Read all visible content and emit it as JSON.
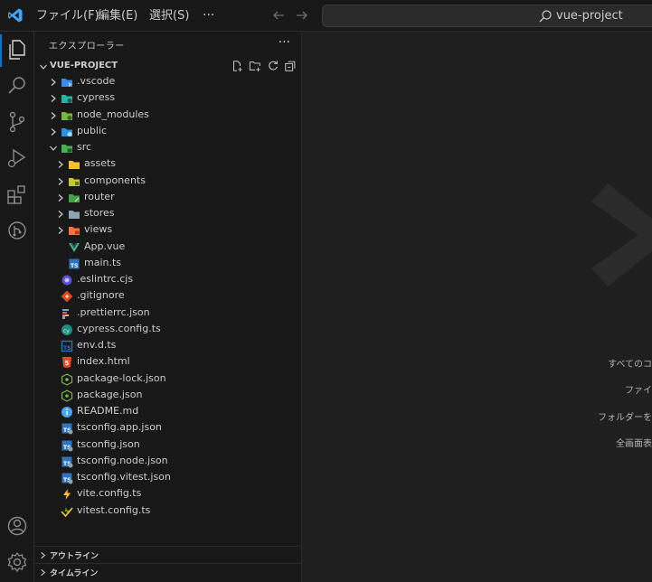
{
  "titlebar": {
    "menus": [
      "ファイル(F)",
      "編集(E)",
      "選択(S)"
    ],
    "more": "···",
    "search_text": "vue-project"
  },
  "sidebar": {
    "title": "エクスプローラー",
    "more": "···",
    "project_name": "VUE-PROJECT",
    "items": [
      {
        "label": ".vscode",
        "type": "folder",
        "icon": "vscode-folder-icon"
      },
      {
        "label": "cypress",
        "type": "folder",
        "icon": "cypress-folder-icon"
      },
      {
        "label": "node_modules",
        "type": "folder",
        "icon": "node-folder-icon"
      },
      {
        "label": "public",
        "type": "folder",
        "icon": "public-folder-icon"
      },
      {
        "label": "src",
        "type": "folder",
        "icon": "src-folder-icon"
      },
      {
        "label": "assets",
        "type": "folder",
        "icon": "assets-folder-icon"
      },
      {
        "label": "components",
        "type": "folder",
        "icon": "components-folder-icon"
      },
      {
        "label": "router",
        "type": "folder",
        "icon": "router-folder-icon"
      },
      {
        "label": "stores",
        "type": "folder",
        "icon": "stores-folder-icon"
      },
      {
        "label": "views",
        "type": "folder",
        "icon": "views-folder-icon"
      },
      {
        "label": "App.vue",
        "type": "file",
        "icon": "vue-file-icon"
      },
      {
        "label": "main.ts",
        "type": "file",
        "icon": "typescript-file-icon"
      },
      {
        "label": ".eslintrc.cjs",
        "type": "file",
        "icon": "eslint-file-icon"
      },
      {
        "label": ".gitignore",
        "type": "file",
        "icon": "git-file-icon"
      },
      {
        "label": ".prettierrc.json",
        "type": "file",
        "icon": "prettier-file-icon"
      },
      {
        "label": "cypress.config.ts",
        "type": "file",
        "icon": "cypress-file-icon"
      },
      {
        "label": "env.d.ts",
        "type": "file",
        "icon": "typescript-def-file-icon"
      },
      {
        "label": "index.html",
        "type": "file",
        "icon": "html-file-icon"
      },
      {
        "label": "package-lock.json",
        "type": "file",
        "icon": "npm-file-icon"
      },
      {
        "label": "package.json",
        "type": "file",
        "icon": "npm-file-icon"
      },
      {
        "label": "README.md",
        "type": "file",
        "icon": "info-file-icon"
      },
      {
        "label": "tsconfig.app.json",
        "type": "file",
        "icon": "tsconfig-file-icon"
      },
      {
        "label": "tsconfig.json",
        "type": "file",
        "icon": "tsconfig-file-icon"
      },
      {
        "label": "tsconfig.node.json",
        "type": "file",
        "icon": "tsconfig-file-icon"
      },
      {
        "label": "tsconfig.vitest.json",
        "type": "file",
        "icon": "tsconfig-file-icon"
      },
      {
        "label": "vite.config.ts",
        "type": "file",
        "icon": "vite-file-icon"
      },
      {
        "label": "vitest.config.ts",
        "type": "file",
        "icon": "vitest-file-icon"
      }
    ],
    "outline_label": "アウトライン",
    "timeline_label": "タイムライン"
  },
  "editor": {
    "hints": [
      "すべてのコ",
      "ファイ",
      "フォルダーを",
      "全画面表"
    ]
  },
  "colors": {
    "accent": "#0078d4",
    "background": "#1f1f1f",
    "sidebar": "#181818"
  }
}
